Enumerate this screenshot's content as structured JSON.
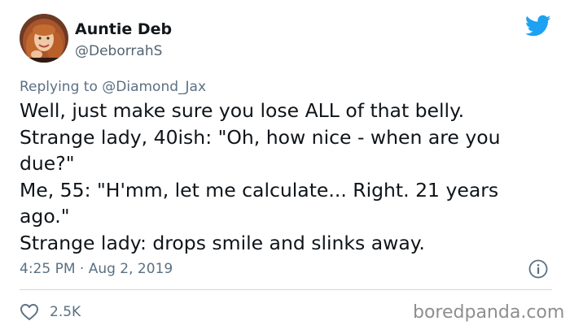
{
  "author": {
    "display_name": "Auntie Deb",
    "handle": "@DeborrahS"
  },
  "reply": {
    "prefix": "Replying to",
    "target": "@Diamond_Jax"
  },
  "tweet": {
    "lines": [
      "Well, just make sure you lose ALL of that belly.",
      "Strange lady, 40ish:  \"Oh, how nice - when are you",
      "due?\"",
      "Me, 55: \"H'mm, let me calculate... Right. 21 years",
      "ago.\"",
      "Strange lady: drops smile and slinks away."
    ]
  },
  "meta": {
    "timestamp": "4:25 PM · Aug 2, 2019"
  },
  "actions": {
    "like_count": "2.5K"
  },
  "watermark": "boredpanda.com",
  "icons": {
    "brand": "twitter-bird-icon",
    "info": "info-icon",
    "like": "heart-icon"
  },
  "colors": {
    "twitter_blue": "#1da1f2",
    "secondary_text": "#5b7083",
    "primary_text": "#0f1419",
    "divider": "#cfd9de"
  }
}
